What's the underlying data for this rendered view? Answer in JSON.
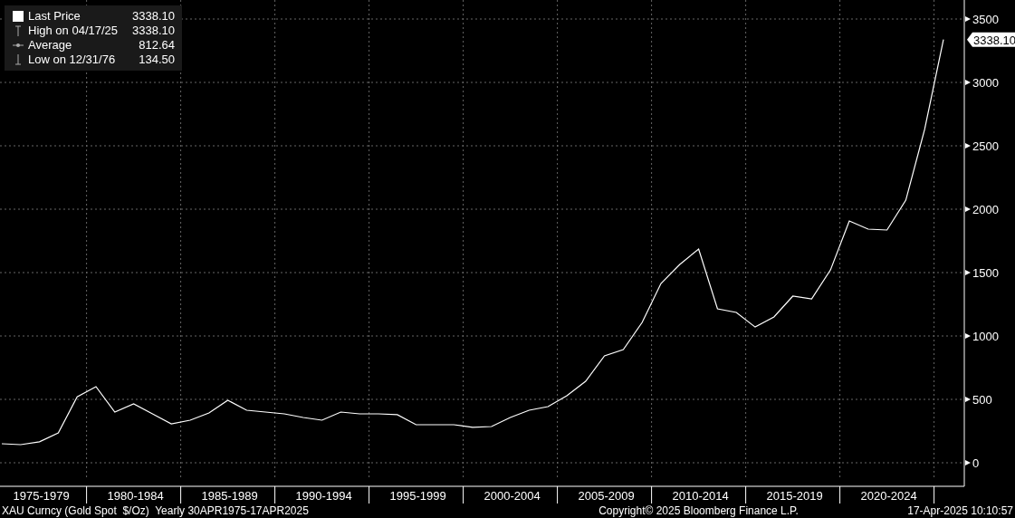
{
  "legend": [
    {
      "kind": "square",
      "value": "3338.10"
    },
    {
      "kind": "high",
      "label": "High on 04/17/25",
      "value": "3338.10"
    },
    {
      "kind": "average",
      "label": "Average",
      "value": "812.64"
    },
    {
      "kind": "low",
      "label": "Low on 12/31/76",
      "value": "134.50"
    }
  ],
  "price_tag": "3338.10",
  "chart_data": {
    "type": "line",
    "categories": [
      null,
      null,
      "1975-1979",
      null,
      null,
      null,
      null,
      "1980-1984",
      null,
      null,
      null,
      null,
      "1985-1989",
      null,
      null,
      null,
      null,
      "1990-1994",
      null,
      null,
      null,
      null,
      "1995-1999",
      null,
      null,
      null,
      null,
      "2000-2004",
      null,
      null,
      null,
      null,
      "2005-2009",
      null,
      null,
      null,
      null,
      "2010-2014",
      null,
      null,
      null,
      null,
      "2015-2019",
      null,
      null,
      null,
      null,
      "2020-2024",
      null,
      null,
      null
    ],
    "series": [
      {
        "name": "Last Price",
        "color": "#ffffff",
        "values": [
          150,
          143,
          165,
          236,
          521,
          600,
          400,
          464,
          386,
          307,
          336,
          393,
          493,
          414,
          400,
          386,
          357,
          336,
          400,
          386,
          386,
          379,
          300,
          300,
          300,
          279,
          286,
          357,
          414,
          443,
          529,
          643,
          843,
          893,
          1107,
          1414,
          1564,
          1686,
          1214,
          1186,
          1071,
          1150,
          1314,
          1293,
          1521,
          1907,
          1843,
          1836,
          2071,
          2629,
          3338
        ]
      }
    ],
    "ylim": [
      0,
      3500
    ],
    "grid": true,
    "yticks": [
      0,
      500,
      1000,
      1500,
      2000,
      2500,
      3000,
      3500
    ]
  },
  "footer": {
    "security": "XAU Curncy (Gold Spot  $/Oz)  Yearly 30APR1975-17APR2025",
    "copyright": "Copyright© 2025 Bloomberg Finance L.P.",
    "timestamp": "17-Apr-2025 10:10:57"
  }
}
